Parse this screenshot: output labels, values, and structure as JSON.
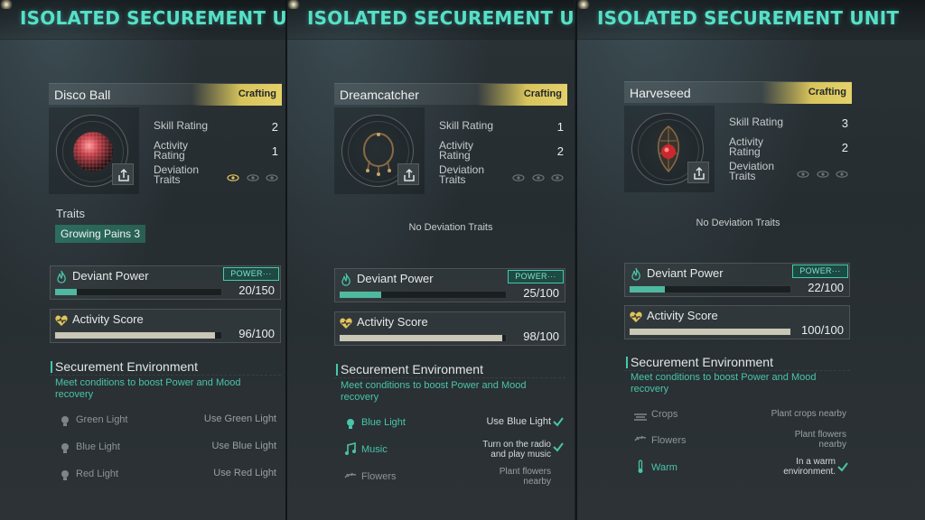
{
  "header_title": "ISOLATED SECUREMENT UNIT",
  "panels": [
    {
      "item_name": "Disco Ball",
      "badge": "Crafting",
      "skill_rating_label": "Skill Rating",
      "skill_rating": "2",
      "activity_rating_label": "Activity Rating",
      "activity_rating": "1",
      "deviation_traits_label": "Deviation Traits",
      "deviation_level": 1,
      "traits_title": "Traits",
      "traits": [
        "Growing Pains 3"
      ],
      "deviant_power_label": "Deviant Power",
      "power_tag": "POWER···",
      "power_value": "20/150",
      "power_fraction": 0.133,
      "activity_score_label": "Activity Score",
      "activity_value": "96/100",
      "activity_fraction": 0.96,
      "env_title": "Securement Environment",
      "env_subtitle": "Meet conditions to boost Power and Mood recovery",
      "env_items": [
        {
          "name": "Green Light",
          "condition": "Use Green Light",
          "met": false,
          "icon": "bulb-icon"
        },
        {
          "name": "Blue Light",
          "condition": "Use Blue Light",
          "met": false,
          "icon": "bulb-icon"
        },
        {
          "name": "Red Light",
          "condition": "Use Red Light",
          "met": false,
          "icon": "bulb-icon"
        }
      ]
    },
    {
      "item_name": "Dreamcatcher",
      "badge": "Crafting",
      "skill_rating_label": "Skill Rating",
      "skill_rating": "1",
      "activity_rating_label": "Activity Rating",
      "activity_rating": "2",
      "deviation_traits_label": "Deviation Traits",
      "deviation_level": 0,
      "no_traits": "No Deviation Traits",
      "deviant_power_label": "Deviant Power",
      "power_tag": "POWER···",
      "power_value": "25/100",
      "power_fraction": 0.25,
      "activity_score_label": "Activity Score",
      "activity_value": "98/100",
      "activity_fraction": 0.98,
      "env_title": "Securement Environment",
      "env_subtitle": "Meet conditions to boost Power and Mood recovery",
      "env_items": [
        {
          "name": "Blue Light",
          "condition": "Use Blue Light",
          "met": true,
          "icon": "bulb-icon"
        },
        {
          "name": "Music",
          "condition_line1": "Turn on the radio",
          "condition_line2": "and play music",
          "met": true,
          "icon": "music-note-icon"
        },
        {
          "name": "Flowers",
          "condition_line1": "Plant flowers",
          "condition_line2": "nearby",
          "met": false,
          "icon": "flower-icon"
        }
      ]
    },
    {
      "item_name": "Harveseed",
      "badge": "Crafting",
      "skill_rating_label": "Skill Rating",
      "skill_rating": "3",
      "activity_rating_label": "Activity Rating",
      "activity_rating": "2",
      "deviation_traits_label": "Deviation Traits",
      "deviation_level": 0,
      "no_traits": "No Deviation Traits",
      "deviant_power_label": "Deviant Power",
      "power_tag": "POWER···",
      "power_value": "22/100",
      "power_fraction": 0.22,
      "activity_score_label": "Activity Score",
      "activity_value": "100/100",
      "activity_fraction": 1.0,
      "env_title": "Securement Environment",
      "env_subtitle": "Meet conditions to boost Power and Mood recovery",
      "env_items": [
        {
          "name": "Crops",
          "condition": "Plant crops nearby",
          "met": false,
          "icon": "crops-icon"
        },
        {
          "name": "Flowers",
          "condition_line1": "Plant flowers",
          "condition_line2": "nearby",
          "met": false,
          "icon": "flower-icon"
        },
        {
          "name": "Warm",
          "condition_line1": "In a warm",
          "condition_line2": "environment.",
          "met": true,
          "icon": "thermometer-icon"
        }
      ]
    }
  ],
  "colors": {
    "accent": "#45c9ad",
    "title": "#56e0c8",
    "badge": "#d8c45b"
  }
}
